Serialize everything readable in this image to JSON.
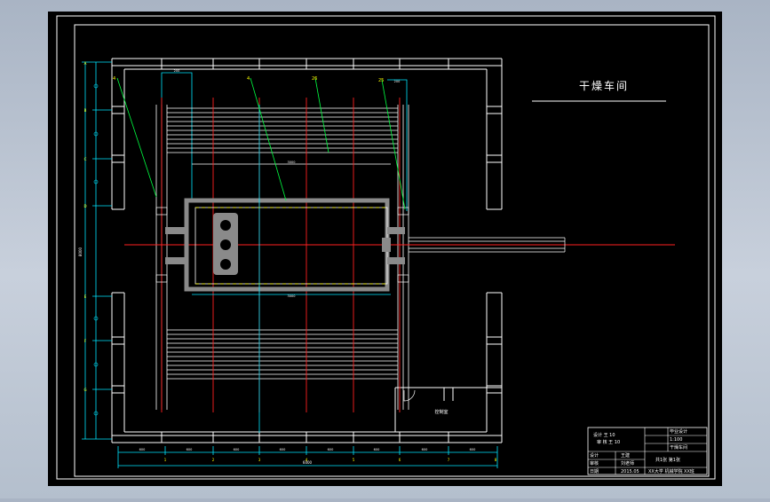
{
  "drawing": {
    "title": "干燥车间",
    "label_door": "控制室",
    "dim_total_bottom": "6000",
    "dim_left_total": "8000",
    "dim_center": "3000",
    "dim_top_small": "200",
    "dim_seg": "600",
    "leader_labels": [
      "4",
      "4",
      "26",
      "25"
    ],
    "axis_nums_bottom": [
      "1",
      "2",
      "3",
      "4",
      "5",
      "6",
      "7",
      "8"
    ],
    "axis_letters_left": [
      "A",
      "B",
      "C",
      "D",
      "E",
      "F",
      "G"
    ]
  },
  "title_block": {
    "r1_left": "设计 王 10",
    "r2_left": "审 核 王 10",
    "r1_right": "毕业设计",
    "r2_right": "1:100",
    "r3_right": "干燥车间",
    "r4_left": "设计",
    "r4_mid": "王建",
    "r5_left": "审核",
    "r5_mid": "刘老师",
    "r6_left": "日期",
    "r6_mid": "2015.05",
    "r6_right": "XX大学 机械学院 XX班",
    "sheet": "共1张 第1张"
  },
  "colors": {
    "canvas": "#000000",
    "frame": "#ffffff",
    "center_line": "#ff2020",
    "cyan": "#00e5ff",
    "green_leader": "#00ff40",
    "yellow": "#ffff00",
    "gray_machine": "#8a8a8a"
  }
}
